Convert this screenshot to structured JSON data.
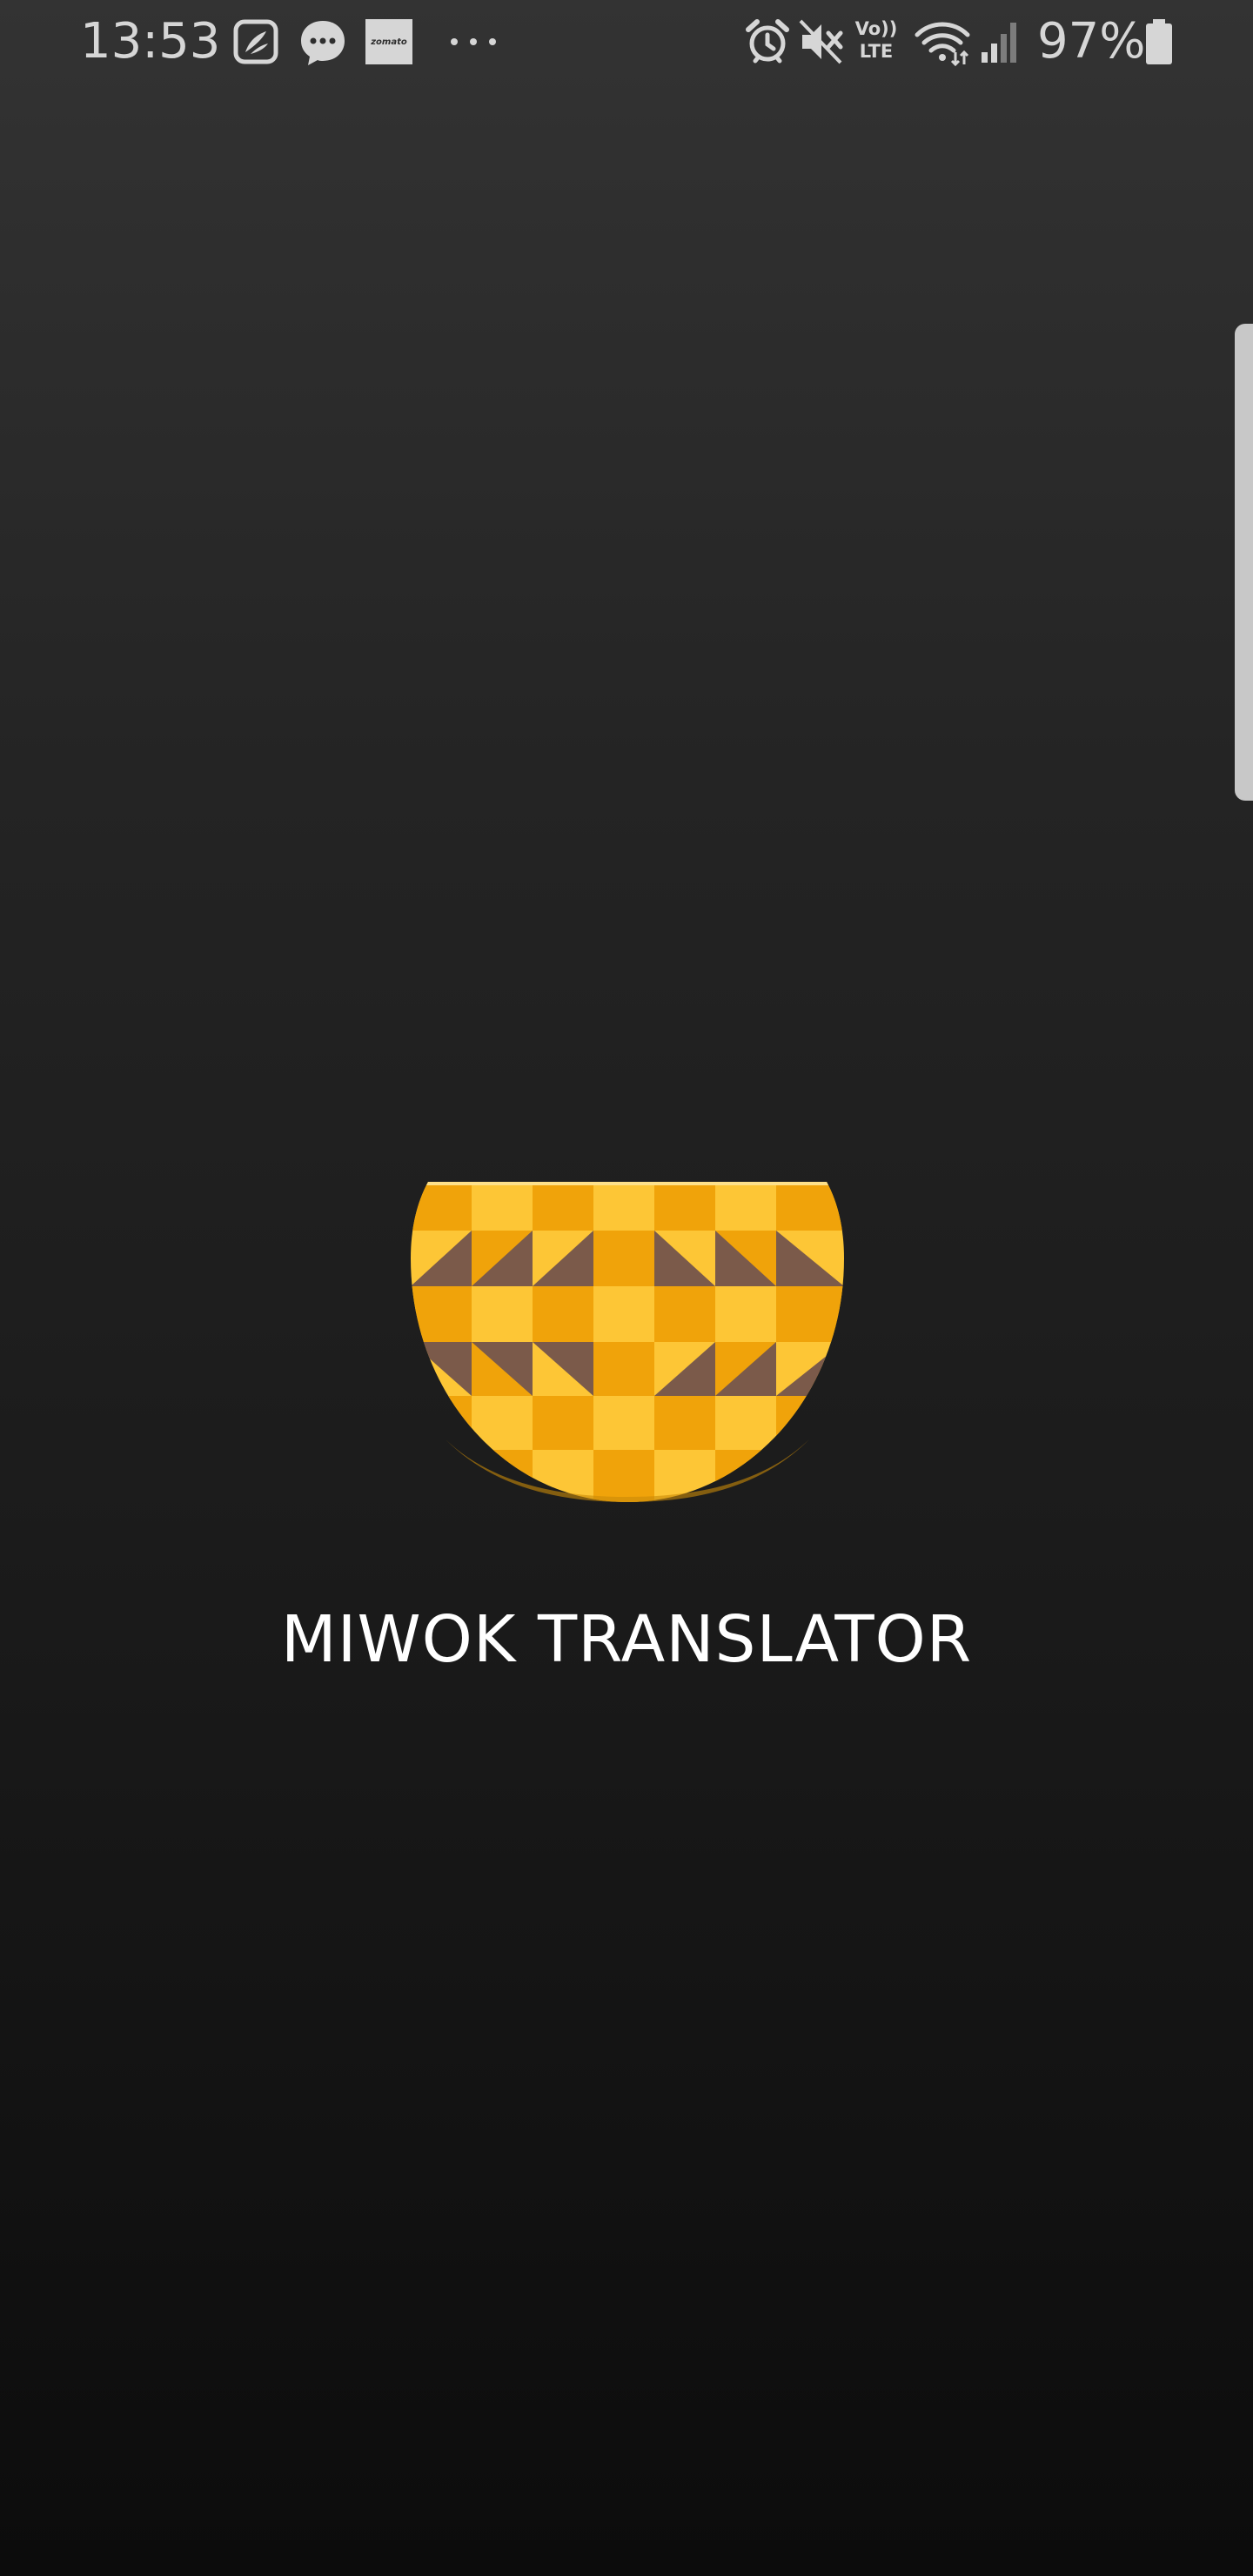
{
  "status_bar": {
    "time": "13:53",
    "battery_percent": "97%",
    "notification_icons": [
      "jiosaavn-icon",
      "messages-icon",
      "zomato-icon",
      "more-notifications-icon"
    ],
    "zomato_label": "zomato",
    "system_icons": [
      "alarm-icon",
      "mute-icon",
      "volte-icon",
      "wifi-icon",
      "signal-icon",
      "battery-icon"
    ],
    "volte_line1": "Vo))",
    "volte_line2": "LTE"
  },
  "splash": {
    "title": "MIWOK TRANSLATOR",
    "logo": "miwok-basket-logo"
  },
  "colors": {
    "background_top": "#333333",
    "background_bottom": "#0c0c0c",
    "logo_light": "#fdc636",
    "logo_dark": "#f0a30a",
    "logo_accent": "#7b5a4a",
    "title_text": "#ffffff"
  }
}
